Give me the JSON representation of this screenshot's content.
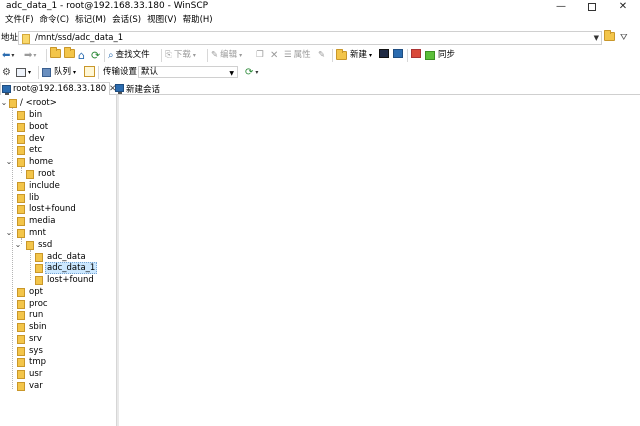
{
  "window": {
    "title": "adc_data_1 - root@192.168.33.180 - WinSCP",
    "minimize": "—",
    "close": "✕"
  },
  "menu": [
    "文件(F)",
    "命令(C)",
    "标记(M)",
    "会话(S)",
    "视图(V)",
    "帮助(H)"
  ],
  "address": {
    "label": "地址",
    "path": "/mnt/ssd/adc_data_1"
  },
  "toolbar1": {
    "find_files": "查找文件",
    "download": "下载",
    "edit": "编辑",
    "properties": "属性",
    "new": "新建",
    "sync": "同步"
  },
  "toolbar2": {
    "queue": "队列",
    "transfer_settings_label": "传输设置",
    "transfer_settings_value": "默认"
  },
  "tabs": {
    "session": "root@192.168.33.180",
    "new_session": "新建会话"
  },
  "tree": {
    "root": "/ <root>",
    "items": [
      "bin",
      "boot",
      "dev",
      "etc",
      "home",
      "root",
      "include",
      "lib",
      "lost+found",
      "media",
      "mnt",
      "ssd",
      "adc_data",
      "adc_data_1",
      "lost+found",
      "opt",
      "proc",
      "run",
      "sbin",
      "srv",
      "sys",
      "tmp",
      "usr",
      "var"
    ],
    "selected": "adc_data_1"
  },
  "colors": {
    "folder": "#f3c54a",
    "selection": "#cce8ff",
    "accent": "#2b6cb0"
  }
}
